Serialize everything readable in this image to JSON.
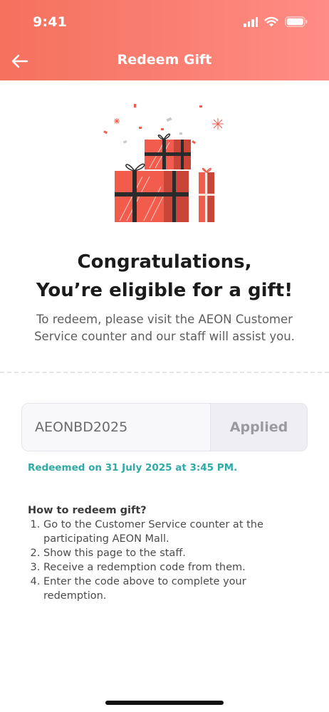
{
  "status_bar": {
    "time": "9:41",
    "icons": [
      "signal-icon",
      "wifi-icon",
      "battery-icon"
    ]
  },
  "header": {
    "title": "Redeem Gift",
    "back_icon": "arrow-left-icon",
    "gradient_start": "#f4715d",
    "gradient_end": "#ff8c85"
  },
  "illustration": {
    "icon": "gift-boxes-illustration",
    "color": "#f25c4c"
  },
  "content": {
    "headline_line1": "Congratulations,",
    "headline_line2": "You’re eligible for a gift!",
    "subtext": "To redeem, please visit the AEON Customer Service counter and our staff will assist you."
  },
  "code": {
    "value": "AEONBD2025",
    "button_label": "Applied"
  },
  "redemption": {
    "status": "Redeemed on 31 July 2025 at 3:45 PM.",
    "accent_color": "#2eaaa7"
  },
  "howto": {
    "title": "How to redeem gift?",
    "steps": [
      "Go to the Customer Service counter at the participating AEON Mall.",
      "Show this page to the staff.",
      "Receive a redemption code from them.",
      "Enter the code above to complete your redemption."
    ]
  }
}
